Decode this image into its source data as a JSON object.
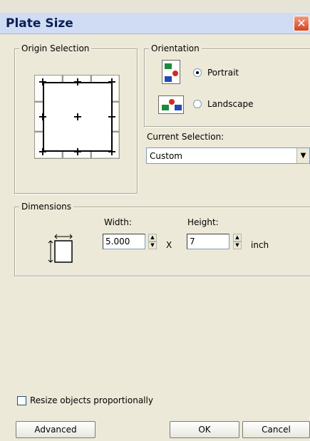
{
  "window": {
    "title": "Plate Size",
    "close_glyph": "✕"
  },
  "origin": {
    "label": "Origin Selection",
    "marks": {
      "plus": "+"
    }
  },
  "orientation": {
    "label": "Orientation",
    "portrait_label": "Portrait",
    "landscape_label": "Landscape",
    "selected": "Portrait"
  },
  "current_selection": {
    "label": "Current Selection:",
    "value": "Custom",
    "arrow_glyph": "▼"
  },
  "dimensions": {
    "label": "Dimensions",
    "width_label": "Width:",
    "height_label": "Height:",
    "width_value": "5.000",
    "height_value": "7",
    "times": "X",
    "unit": "inch",
    "spin_up": "▲",
    "spin_down": "▼"
  },
  "resize": {
    "label": "Resize objects proportionally",
    "checked": false
  },
  "buttons": {
    "advanced": "Advanced",
    "ok": "OK",
    "cancel": "Cancel"
  }
}
